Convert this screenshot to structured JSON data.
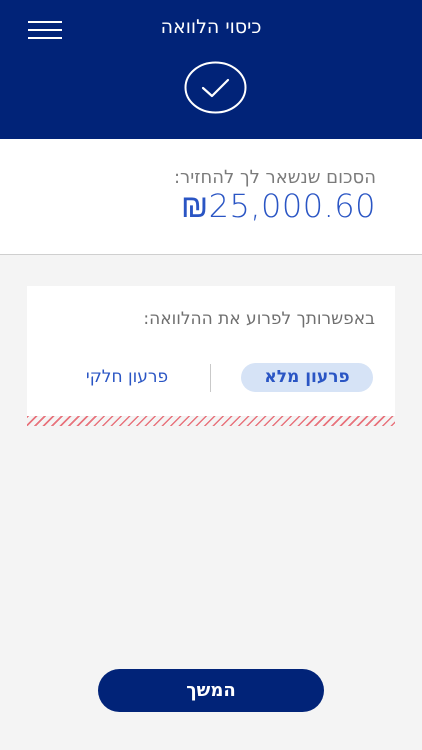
{
  "header": {
    "title": "כיסוי הלוואה",
    "menu_icon": "hamburger-menu-icon",
    "status_icon": "check-circle-icon",
    "background_color": "#012378"
  },
  "balance": {
    "label": "הסכום שנשאר לך להחזיר:",
    "amount": "₪25,000.60",
    "amount_color": "#2a55c4"
  },
  "repayment": {
    "label": "באפשרותך לפרוע את ההלוואה:",
    "options": [
      {
        "label": "פרעון מלא",
        "selected": true
      },
      {
        "label": "פרעון חלקי",
        "selected": false
      }
    ]
  },
  "footer": {
    "continue_label": "המשך"
  }
}
